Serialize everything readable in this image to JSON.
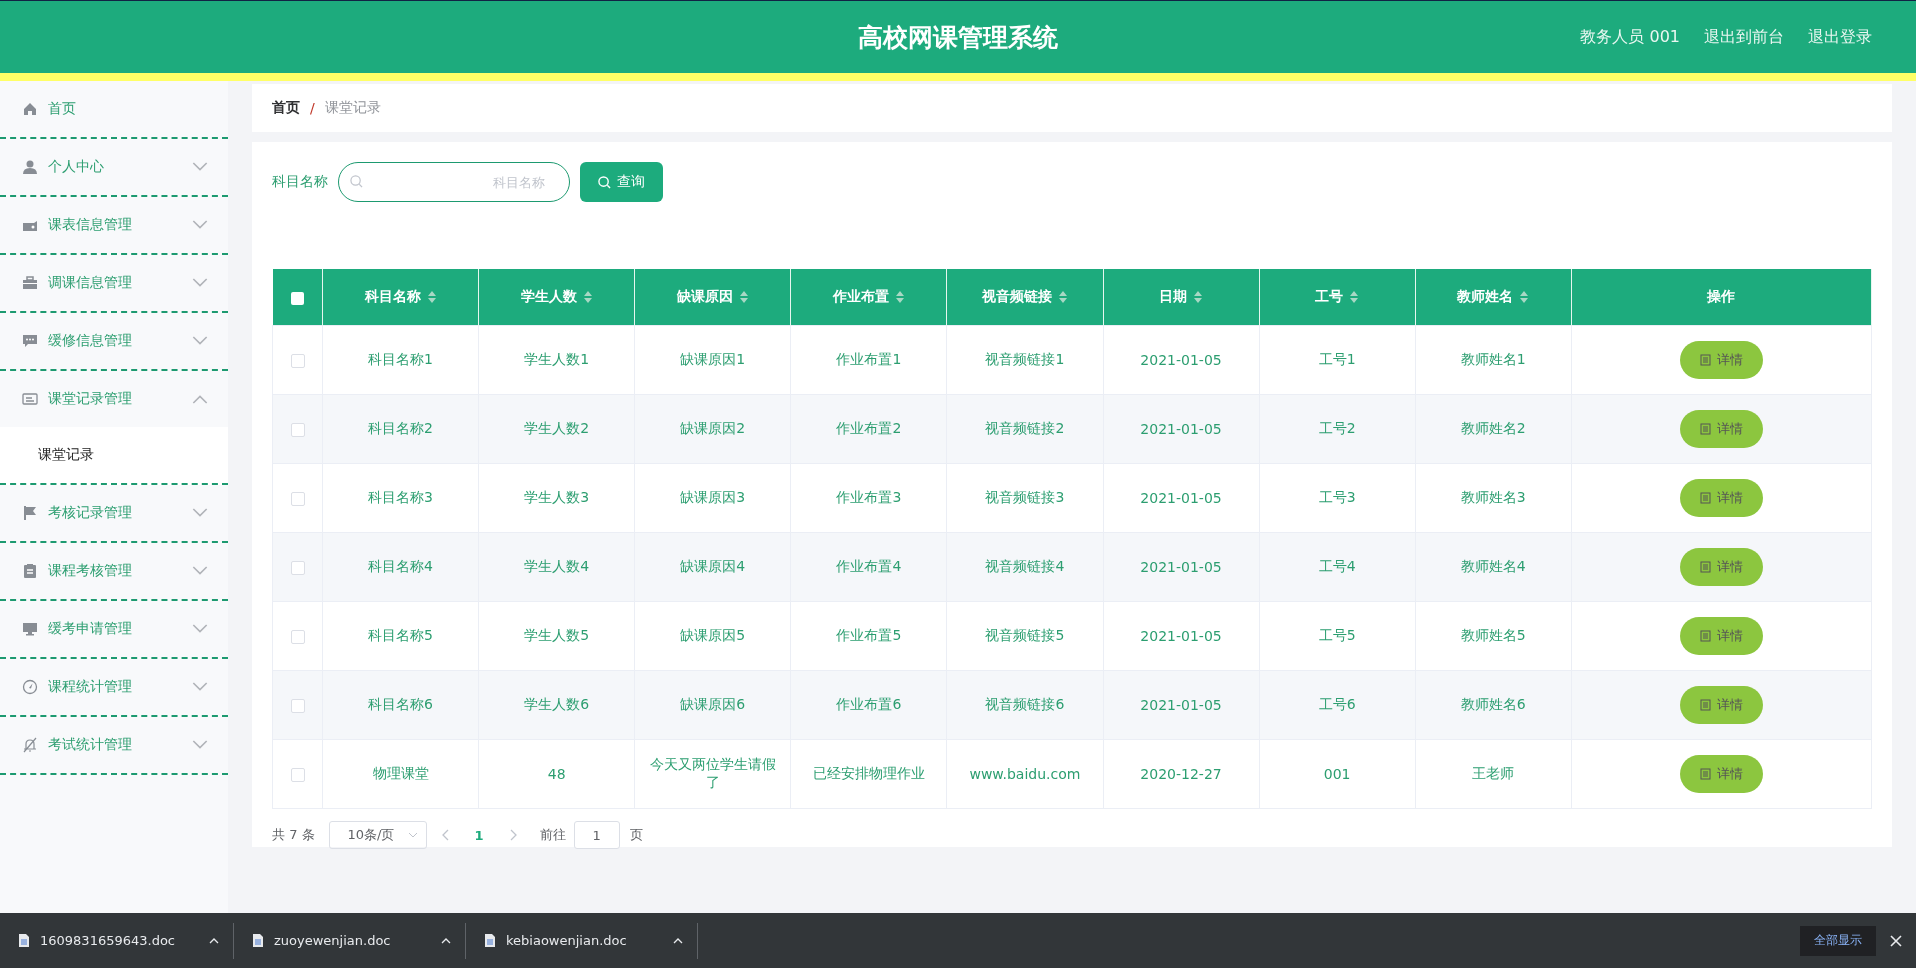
{
  "header": {
    "title": "高校网课管理系统",
    "user": "教务人员 001",
    "links": [
      "退出到前台",
      "退出登录"
    ]
  },
  "sidebar": {
    "items": [
      {
        "label": "首页",
        "kind": "link"
      },
      {
        "label": "个人中心",
        "kind": "menu",
        "expanded": false
      },
      {
        "label": "课表信息管理",
        "kind": "menu",
        "expanded": false
      },
      {
        "label": "调课信息管理",
        "kind": "menu",
        "expanded": false
      },
      {
        "label": "缓修信息管理",
        "kind": "menu",
        "expanded": false
      },
      {
        "label": "课堂记录管理",
        "kind": "menu",
        "expanded": true,
        "children": [
          {
            "label": "课堂记录"
          }
        ]
      },
      {
        "label": "考核记录管理",
        "kind": "menu",
        "expanded": false
      },
      {
        "label": "课程考核管理",
        "kind": "menu",
        "expanded": false
      },
      {
        "label": "缓考申请管理",
        "kind": "menu",
        "expanded": false
      },
      {
        "label": "课程统计管理",
        "kind": "menu",
        "expanded": false
      },
      {
        "label": "考试统计管理",
        "kind": "menu",
        "expanded": false
      }
    ]
  },
  "breadcrumb": {
    "separator": "/",
    "items": [
      "首页",
      "课堂记录"
    ]
  },
  "search": {
    "label": "科目名称",
    "placeholder": "科目名称",
    "button": "查询"
  },
  "table": {
    "select_all_checked": false,
    "columns": [
      {
        "label": "科目名称",
        "sortable": true
      },
      {
        "label": "学生人数",
        "sortable": true
      },
      {
        "label": "缺课原因",
        "sortable": true
      },
      {
        "label": "作业布置",
        "sortable": true
      },
      {
        "label": "视音频链接",
        "sortable": true
      },
      {
        "label": "日期",
        "sortable": true
      },
      {
        "label": "工号",
        "sortable": true
      },
      {
        "label": "教师姓名",
        "sortable": true
      },
      {
        "label": "操作",
        "sortable": false
      }
    ],
    "rows": [
      {
        "checked": false,
        "cells": [
          "科目名称1",
          "学生人数1",
          "缺课原因1",
          "作业布置1",
          "视音频链接1",
          "2021-01-05",
          "工号1",
          "教师姓名1"
        ],
        "action": "详情"
      },
      {
        "checked": false,
        "cells": [
          "科目名称2",
          "学生人数2",
          "缺课原因2",
          "作业布置2",
          "视音频链接2",
          "2021-01-05",
          "工号2",
          "教师姓名2"
        ],
        "action": "详情"
      },
      {
        "checked": false,
        "cells": [
          "科目名称3",
          "学生人数3",
          "缺课原因3",
          "作业布置3",
          "视音频链接3",
          "2021-01-05",
          "工号3",
          "教师姓名3"
        ],
        "action": "详情"
      },
      {
        "checked": false,
        "cells": [
          "科目名称4",
          "学生人数4",
          "缺课原因4",
          "作业布置4",
          "视音频链接4",
          "2021-01-05",
          "工号4",
          "教师姓名4"
        ],
        "action": "详情"
      },
      {
        "checked": false,
        "cells": [
          "科目名称5",
          "学生人数5",
          "缺课原因5",
          "作业布置5",
          "视音频链接5",
          "2021-01-05",
          "工号5",
          "教师姓名5"
        ],
        "action": "详情"
      },
      {
        "checked": false,
        "cells": [
          "科目名称6",
          "学生人数6",
          "缺课原因6",
          "作业布置6",
          "视音频链接6",
          "2021-01-05",
          "工号6",
          "教师姓名6"
        ],
        "action": "详情"
      },
      {
        "checked": false,
        "cells": [
          "物理课堂",
          "48",
          "今天又两位学生请假了",
          "已经安排物理作业",
          "www.baidu.com",
          "2020-12-27",
          "001",
          "王老师"
        ],
        "action": "详情"
      }
    ]
  },
  "pagination": {
    "total": "共 7 条",
    "page_size": "10条/页",
    "pages": [
      {
        "label": "1",
        "selected": true
      }
    ],
    "goto_label": "前往",
    "goto_value": "1",
    "goto_suffix": "页"
  },
  "downloads": {
    "files": [
      "1609831659643.doc",
      "zuoyewenjian.doc",
      "kebiaowenjian.doc"
    ],
    "show_all": "全部显示"
  }
}
